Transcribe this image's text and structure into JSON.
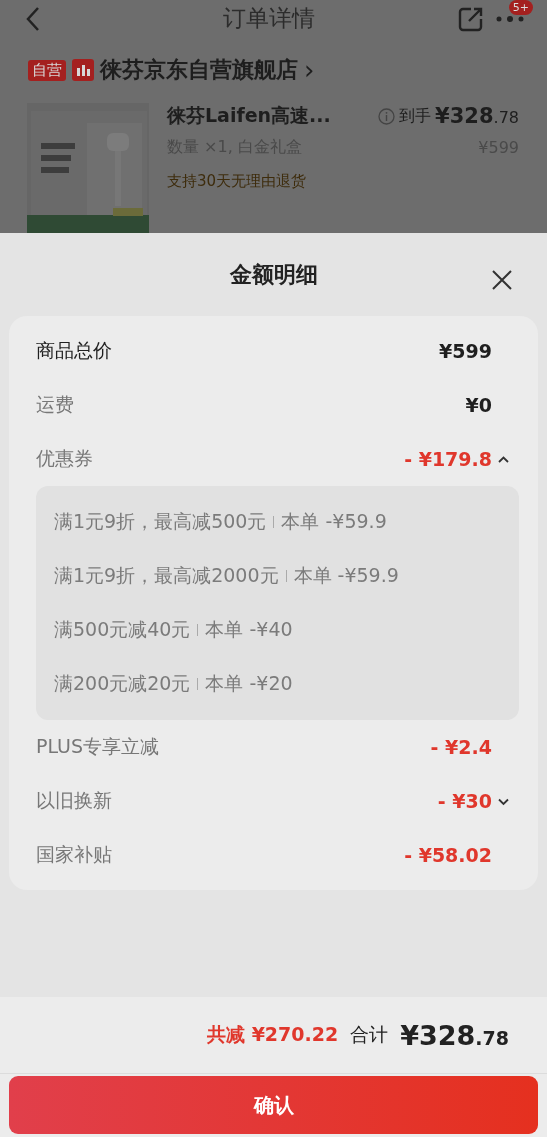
{
  "header": {
    "title": "订单详情",
    "badge": "5+"
  },
  "store": {
    "tag": "自营",
    "name": "徕芬京东自营旗舰店",
    "chevron": "›"
  },
  "product": {
    "kind": "picture",
    "name": "徕芬Laifen高速...",
    "spec": "数量 ×1, 白金礼盒",
    "promise": "支持30天无理由退货",
    "final_label": "到手",
    "final_price": "¥328.78",
    "price": "¥599"
  },
  "sheet": {
    "title": "金额明细",
    "rows": [
      {
        "kind": "total",
        "label": "商品总价",
        "amount": "¥599"
      },
      {
        "kind": "fee",
        "label": "运费",
        "amount": "¥0"
      },
      {
        "kind": "discount",
        "label": "优惠券",
        "amount": "- ¥179.8",
        "expanded": true,
        "details": [
          {
            "condition": "满1元9折，最高减500元",
            "saving": "本单 -¥59.9"
          },
          {
            "condition": "满1元9折，最高减2000元",
            "saving": "本单 -¥59.9"
          },
          {
            "condition": "满500元减40元",
            "saving": "本单 -¥40"
          },
          {
            "condition": "满200元减20元",
            "saving": "本单 -¥20"
          }
        ]
      },
      {
        "kind": "discount",
        "label": "PLUS专享立减",
        "amount": "- ¥2.4"
      },
      {
        "kind": "discount",
        "label": "以旧换新",
        "amount": "- ¥30",
        "expanded": false
      },
      {
        "kind": "discount",
        "label": "国家补贴",
        "amount": "- ¥58.02"
      }
    ]
  },
  "footer": {
    "saved": "共减 ¥270.22",
    "total_label": "合计",
    "total_amount": "¥328.78",
    "confirm": "确认"
  }
}
